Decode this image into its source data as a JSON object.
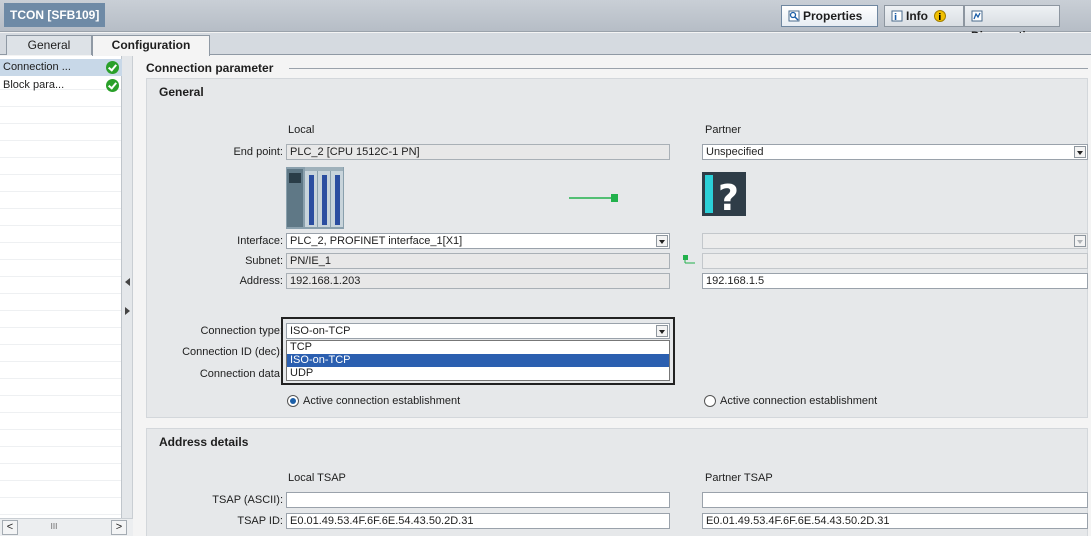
{
  "window": {
    "title": "TCON [SFB109]"
  },
  "top_tabs": {
    "properties": "Properties",
    "info": "Info",
    "diagnostics": "Diagnostics"
  },
  "tabs": {
    "general": "General",
    "configuration": "Configuration"
  },
  "nav": {
    "items": [
      {
        "label": "Connection ...",
        "status": "ok"
      },
      {
        "label": "Block para...",
        "status": "ok"
      }
    ]
  },
  "connection": {
    "section_title": "Connection parameter",
    "panel_title": "General",
    "local_header": "Local",
    "partner_header": "Partner",
    "labels": {
      "end_point": "End point:",
      "interface": "Interface:",
      "subnet": "Subnet:",
      "address": "Address:",
      "connection_type": "Connection type:",
      "connection_id": "Connection ID (dec):",
      "connection_data": "Connection data:"
    },
    "local": {
      "end_point": "PLC_2 [CPU 1512C-1 PN]",
      "interface": "PLC_2, PROFINET interface_1[X1]",
      "subnet": "PN/IE_1",
      "address": "192.168.1.203"
    },
    "partner": {
      "end_point": "Unspecified",
      "interface": "",
      "subnet": "",
      "address": "192.168.1.5"
    },
    "connection_type": {
      "value": "ISO-on-TCP",
      "options": [
        "TCP",
        "ISO-on-TCP",
        "UDP"
      ],
      "selected_index": 1
    },
    "local_active": "Active connection establishment",
    "partner_active": "Active connection establishment"
  },
  "address_details": {
    "panel_title": "Address details",
    "local_tsap_header": "Local TSAP",
    "partner_tsap_header": "Partner TSAP",
    "labels": {
      "tsap_ascii": "TSAP (ASCII):",
      "tsap_id": "TSAP ID:"
    },
    "local": {
      "tsap_ascii": "",
      "tsap_id": "E0.01.49.53.4F.6F.6E.54.43.50.2D.31"
    },
    "partner": {
      "tsap_ascii": "",
      "tsap_id": "E0.01.49.53.4F.6F.6E.54.43.50.2D.31"
    }
  },
  "colors": {
    "accent": "#2b5fb0",
    "ok": "#2aa02a",
    "link": "#22b14c",
    "device_teal": "#2bd0d8"
  }
}
